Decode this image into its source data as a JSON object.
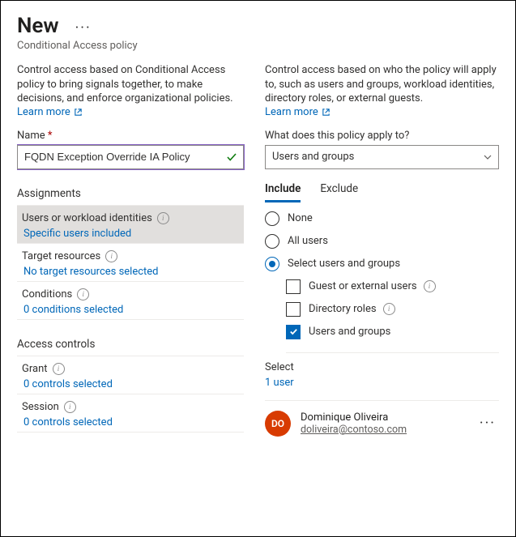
{
  "header": {
    "title": "New",
    "subtitle": "Conditional Access policy"
  },
  "left": {
    "description": "Control access based on Conditional Access policy to bring signals together, to make decisions, and enforce organizational policies.",
    "learn_more": "Learn more",
    "name_label": "Name",
    "name_value": "FQDN Exception Override IA Policy",
    "assignments_heading": "Assignments",
    "users_item": {
      "title": "Users or workload identities",
      "status": "Specific users included"
    },
    "target_item": {
      "title": "Target resources",
      "status": "No target resources selected"
    },
    "conditions_item": {
      "title": "Conditions",
      "status": "0 conditions selected"
    },
    "access_heading": "Access controls",
    "grant_item": {
      "title": "Grant",
      "status": "0 controls selected"
    },
    "session_item": {
      "title": "Session",
      "status": "0 controls selected"
    }
  },
  "right": {
    "description": "Control access based on who the policy will apply to, such as users and groups, workload identities, directory roles, or external guests.",
    "learn_more": "Learn more",
    "apply_label": "What does this policy apply to?",
    "apply_value": "Users and groups",
    "tabs": {
      "include": "Include",
      "exclude": "Exclude"
    },
    "radios": {
      "none": "None",
      "all": "All users",
      "select": "Select users and groups"
    },
    "checks": {
      "guest": "Guest or external users",
      "roles": "Directory roles",
      "users_groups": "Users and groups"
    },
    "select_label": "Select",
    "user_count": "1 user",
    "user": {
      "initials": "DO",
      "name": "Dominique Oliveira",
      "email": "doliveira@contoso.com"
    }
  }
}
